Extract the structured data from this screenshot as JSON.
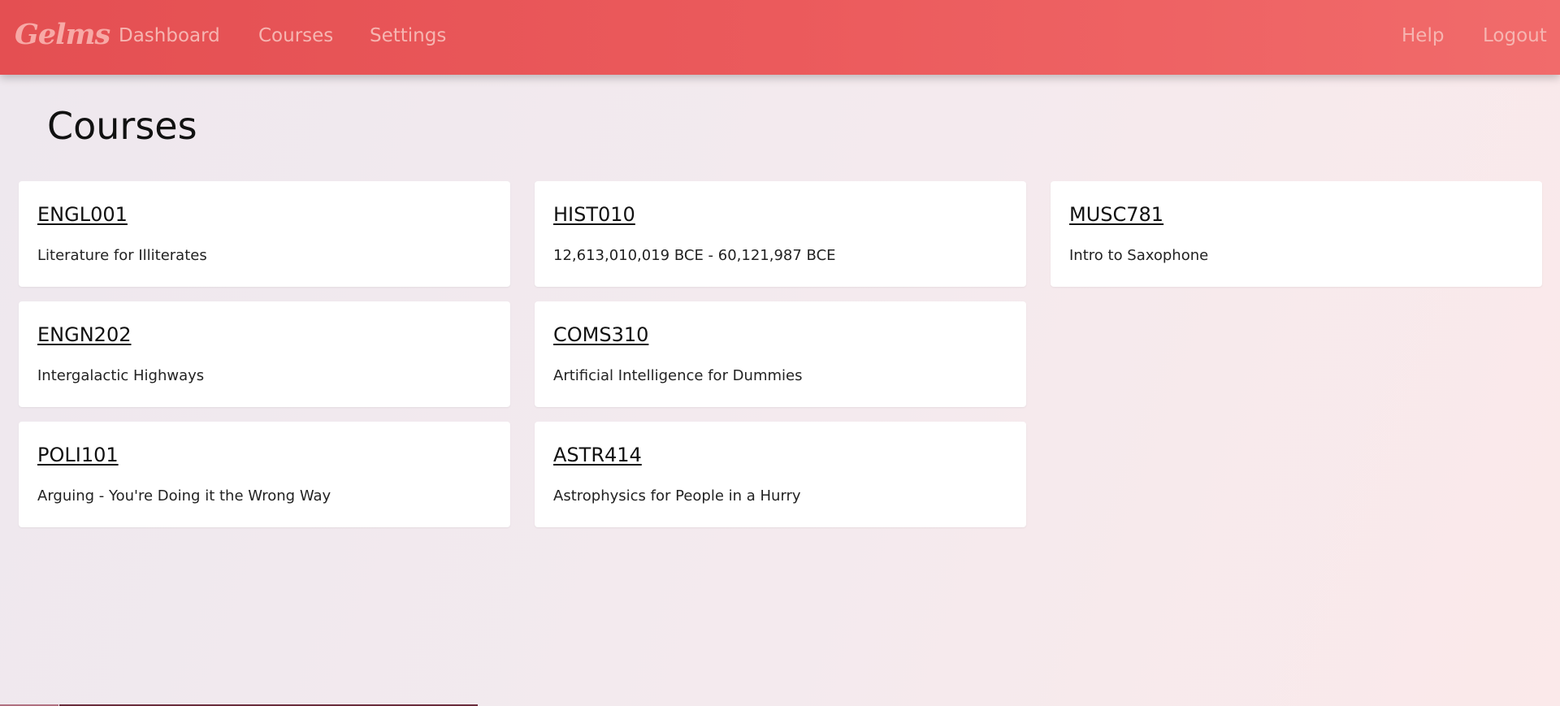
{
  "header": {
    "logo": "Gelms",
    "nav": {
      "dashboard": "Dashboard",
      "courses": "Courses",
      "settings": "Settings",
      "help": "Help",
      "logout": "Logout"
    }
  },
  "page": {
    "title": "Courses"
  },
  "courses": [
    {
      "code": "ENGL001",
      "description": "Literature for Illiterates"
    },
    {
      "code": "HIST010",
      "description": "12,613,010,019 BCE - 60,121,987 BCE"
    },
    {
      "code": "MUSC781",
      "description": "Intro to Saxophone"
    },
    {
      "code": "ENGN202",
      "description": "Intergalactic Highways"
    },
    {
      "code": "COMS310",
      "description": "Artificial Intelligence for Dummies"
    },
    {
      "code": "POLI101",
      "description": "Arguing - You're Doing it the Wrong Way"
    },
    {
      "code": "ASTR414",
      "description": "Astrophysics for People in a Hurry"
    }
  ],
  "colors": {
    "header_start": "#e44f52",
    "header_end": "#f16b6b",
    "nav_text": "#f6b5b1",
    "card_bg": "#ffffff"
  }
}
